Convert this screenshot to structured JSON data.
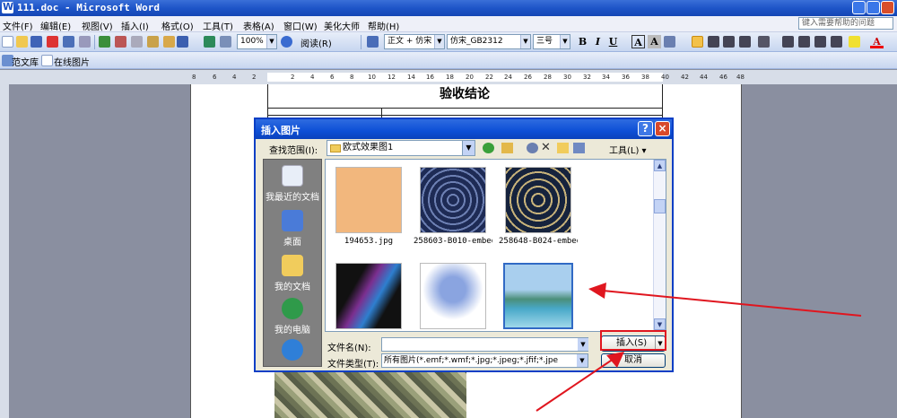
{
  "window": {
    "title": "111.doc - Microsoft Word"
  },
  "menu": {
    "items": [
      "文件(F)",
      "编辑(E)",
      "视图(V)",
      "插入(I)",
      "格式(O)",
      "工具(T)",
      "表格(A)",
      "窗口(W)",
      "美化大师",
      "帮助(H)"
    ],
    "help_placeholder": "键入需要帮助的问题"
  },
  "toolbar": {
    "zoom": "100%",
    "read_label": "阅读(R)",
    "style": "正文 + 仿宋",
    "font": "仿宋_GB2312",
    "size": "三号",
    "bold": "B",
    "italic": "I",
    "underline": "U",
    "charborder": "A",
    "charshade": "A",
    "fontcolor": "A"
  },
  "toolbar2": {
    "items": [
      "范文库",
      "在线图片"
    ]
  },
  "ruler": {
    "numbers": [
      "8",
      "6",
      "4",
      "2",
      "2",
      "4",
      "6",
      "8",
      "10",
      "12",
      "14",
      "16",
      "18",
      "20",
      "22",
      "24",
      "26",
      "28",
      "30",
      "32",
      "34",
      "36",
      "38",
      "40",
      "42",
      "44",
      "46",
      "48"
    ]
  },
  "document": {
    "heading": "验收结论"
  },
  "dialog": {
    "title": "插入图片",
    "help_btn": "?",
    "close_btn": "×",
    "look_in_label": "查找范围(I):",
    "look_in_value": "欧式效果图1",
    "tools_label": "工具(L) ▾",
    "places": [
      "我最近的文档",
      "桌面",
      "我的文档",
      "我的电脑",
      ""
    ],
    "files": [
      {
        "name": "194653.jpg"
      },
      {
        "name": "258603-B010-embed..."
      },
      {
        "name": "258648-B024-embed..."
      },
      {
        "name": ""
      },
      {
        "name": ""
      },
      {
        "name": ""
      }
    ],
    "filename_label": "文件名(N):",
    "filename_value": "",
    "filetype_label": "文件类型(T):",
    "filetype_value": "所有图片(*.emf;*.wmf;*.jpg;*.jpeg;*.jfif;*.jpe",
    "insert_label": "插入(S)",
    "cancel_label": "取消"
  },
  "colors": {
    "titlebar": "#1e55c8",
    "dialog_border": "#0a3fc5",
    "selection": "#316ac5",
    "annotation": "#e0161f"
  }
}
